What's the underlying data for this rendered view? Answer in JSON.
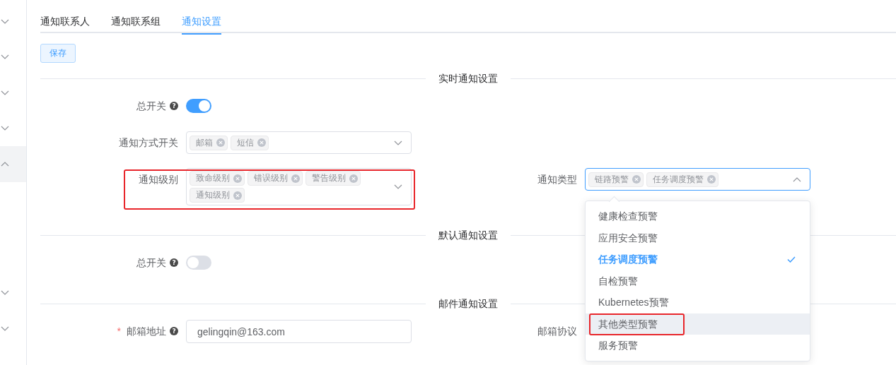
{
  "sidebar": {
    "items": [
      {
        "expanded": false
      },
      {
        "expanded": false
      },
      {
        "expanded": false
      },
      {
        "expanded": false
      },
      {
        "expanded": true
      },
      {
        "expanded": false
      },
      {
        "expanded": false
      }
    ]
  },
  "tabs": [
    {
      "label": "通知联系人",
      "selected": false
    },
    {
      "label": "通知联系组",
      "selected": false
    },
    {
      "label": "通知设置",
      "selected": true
    }
  ],
  "save_button": "保存",
  "sections": [
    {
      "title": "实时通知设置",
      "rows": [
        [
          {
            "kind": "switch",
            "label": "总开关",
            "help": "?",
            "on": true
          }
        ],
        [
          {
            "kind": "tags",
            "label": "通知方式开关",
            "tags": [
              "邮箱",
              "短信"
            ],
            "open": false
          }
        ],
        [
          {
            "kind": "tags",
            "label": "通知级别",
            "tags": [
              "致命级别",
              "错误级别",
              "警告级别",
              "通知级别"
            ],
            "open": false,
            "highlighted": true
          },
          {
            "kind": "tags",
            "label": "通知类型",
            "tags": [
              "链路预警",
              "任务调度预警"
            ],
            "open": true,
            "options": [
              {
                "label": "健康检查预警",
                "selected": false,
                "hovered": false,
                "highlighted": false
              },
              {
                "label": "应用安全预警",
                "selected": false,
                "hovered": false,
                "highlighted": false
              },
              {
                "label": "任务调度预警",
                "selected": true,
                "hovered": false,
                "highlighted": false
              },
              {
                "label": "自检预警",
                "selected": false,
                "hovered": false,
                "highlighted": false
              },
              {
                "label": "Kubernetes预警",
                "selected": false,
                "hovered": false,
                "highlighted": false
              },
              {
                "label": "其他类型预警",
                "selected": false,
                "hovered": true,
                "highlighted": true
              },
              {
                "label": "服务预警",
                "selected": false,
                "hovered": false,
                "highlighted": false
              }
            ]
          }
        ]
      ]
    },
    {
      "title": "默认通知设置",
      "rows": [
        [
          {
            "kind": "switch",
            "label": "总开关",
            "help": "?",
            "on": false
          }
        ]
      ]
    },
    {
      "title": "邮件通知设置",
      "rows": [
        [
          {
            "kind": "input",
            "label": "邮箱地址",
            "required": "*",
            "help": "?",
            "value": "gelingqin@163.com"
          },
          {
            "kind": "select",
            "label": "邮箱协议"
          }
        ]
      ]
    }
  ]
}
